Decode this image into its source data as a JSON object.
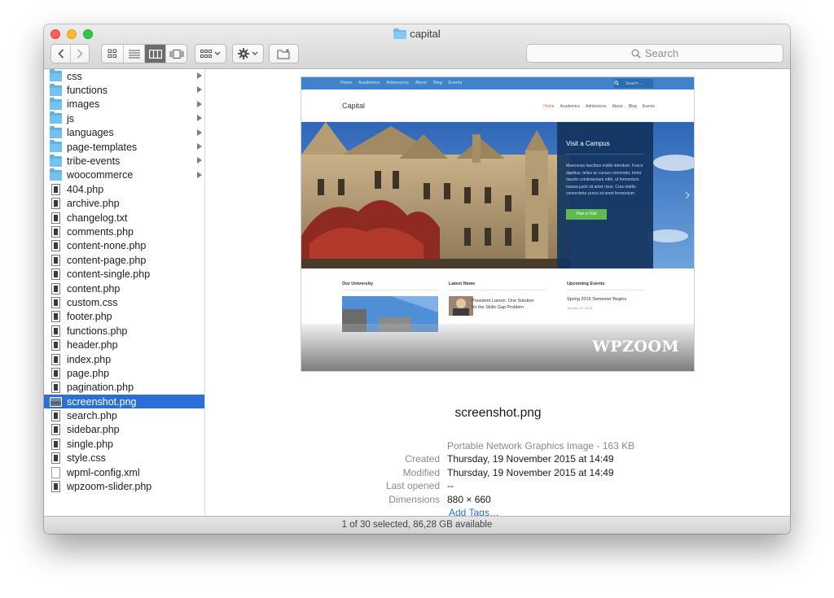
{
  "window": {
    "title": "capital"
  },
  "toolbar": {
    "search_placeholder": "Search"
  },
  "sidebar": {
    "items": [
      {
        "label": "css",
        "kind": "folder"
      },
      {
        "label": "functions",
        "kind": "folder"
      },
      {
        "label": "images",
        "kind": "folder"
      },
      {
        "label": "js",
        "kind": "folder"
      },
      {
        "label": "languages",
        "kind": "folder"
      },
      {
        "label": "page-templates",
        "kind": "folder"
      },
      {
        "label": "tribe-events",
        "kind": "folder"
      },
      {
        "label": "woocommerce",
        "kind": "folder"
      },
      {
        "label": "404.php",
        "kind": "doc"
      },
      {
        "label": "archive.php",
        "kind": "doc"
      },
      {
        "label": "changelog.txt",
        "kind": "doc"
      },
      {
        "label": "comments.php",
        "kind": "doc"
      },
      {
        "label": "content-none.php",
        "kind": "doc"
      },
      {
        "label": "content-page.php",
        "kind": "doc"
      },
      {
        "label": "content-single.php",
        "kind": "doc"
      },
      {
        "label": "content.php",
        "kind": "doc"
      },
      {
        "label": "custom.css",
        "kind": "doc"
      },
      {
        "label": "footer.php",
        "kind": "doc"
      },
      {
        "label": "functions.php",
        "kind": "doc"
      },
      {
        "label": "header.php",
        "kind": "doc"
      },
      {
        "label": "index.php",
        "kind": "doc"
      },
      {
        "label": "page.php",
        "kind": "doc"
      },
      {
        "label": "pagination.php",
        "kind": "doc"
      },
      {
        "label": "screenshot.png",
        "kind": "image",
        "selected": true
      },
      {
        "label": "search.php",
        "kind": "doc"
      },
      {
        "label": "sidebar.php",
        "kind": "doc"
      },
      {
        "label": "single.php",
        "kind": "doc"
      },
      {
        "label": "style.css",
        "kind": "doc"
      },
      {
        "label": "wpml-config.xml",
        "kind": "blank"
      },
      {
        "label": "wpzoom-slider.php",
        "kind": "doc"
      }
    ]
  },
  "thumbnail": {
    "top_links": [
      "Home",
      "Academics",
      "Admissions",
      "About",
      "Blog",
      "Events"
    ],
    "search_placeholder": "Search ...",
    "logo": "Capital",
    "menu": [
      "Home",
      "Academics",
      "Admissions",
      "About",
      "Blog",
      "Events"
    ],
    "panel_title": "Visit a Campus",
    "panel_text": "Maecenas faucibus mollis interdum. Fusce dapibus, tellus ac cursus commodo, tortor mauris condimentum nibh, ut fermentum massa justo sit amet risus. Cras mattis consectetur purus sit amet fermentum.",
    "panel_button": "Plan a Visit",
    "col1_heading": "Our University",
    "col2_heading": "Latest News",
    "col3_heading": "Upcoming Events",
    "news_title": "President Larson: One Solution for the Skills Gap Problem",
    "event_title": "Spring 2015 Semester Begins",
    "event_date": "January 22, 2016",
    "brand": "WPZOOM"
  },
  "preview": {
    "filename": "screenshot.png",
    "kind": "Portable Network Graphics Image - 163 KB",
    "fields": [
      {
        "key": "Created",
        "value": "Thursday, 19 November 2015 at 14:49"
      },
      {
        "key": "Modified",
        "value": "Thursday, 19 November 2015 at 14:49"
      },
      {
        "key": "Last opened",
        "value": "--"
      },
      {
        "key": "Dimensions",
        "value": "880 × 660"
      }
    ],
    "add_tags": "Add Tags…"
  },
  "status": {
    "text": "1 of 30 selected, 86,28 GB available"
  },
  "colors": {
    "selection": "#2a6ed8",
    "folder": "#74c2f1",
    "link": "#2a6ed8"
  }
}
